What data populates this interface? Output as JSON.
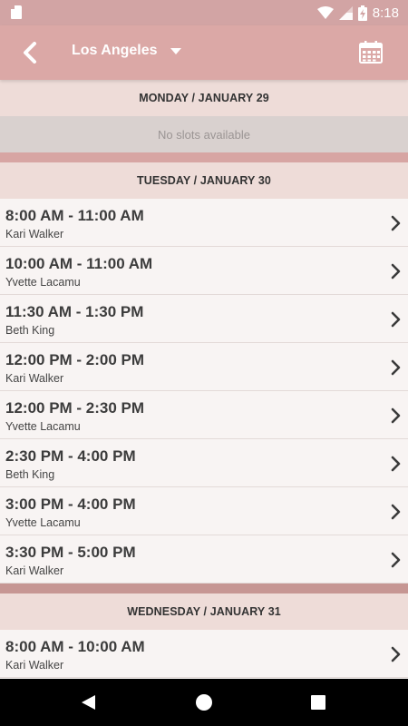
{
  "status_bar": {
    "time": "8:18",
    "icons": [
      "sd-card-icon",
      "wifi-icon",
      "signal-icon",
      "battery-charging-icon"
    ]
  },
  "app_bar": {
    "back_icon": "chevron-left-icon",
    "city": "Los Angeles",
    "dropdown_icon": "caret-down-icon",
    "calendar_icon": "calendar-icon"
  },
  "days": [
    {
      "header": "MONDAY / JANUARY 29",
      "empty_text": "No slots available"
    },
    {
      "header": "TUESDAY / JANUARY 30",
      "slots": [
        {
          "time": "8:00 AM - 11:00 AM",
          "name": "Kari Walker"
        },
        {
          "time": "10:00 AM - 11:00 AM",
          "name": "Yvette Lacamu"
        },
        {
          "time": "11:30 AM - 1:30 PM",
          "name": "Beth King"
        },
        {
          "time": "12:00 PM - 2:00 PM",
          "name": "Kari Walker"
        },
        {
          "time": "12:00 PM - 2:30 PM",
          "name": "Yvette Lacamu"
        },
        {
          "time": "2:30 PM - 4:00 PM",
          "name": "Beth King"
        },
        {
          "time": "3:00 PM - 4:00 PM",
          "name": "Yvette Lacamu"
        },
        {
          "time": "3:30 PM - 5:00 PM",
          "name": "Kari Walker"
        }
      ]
    },
    {
      "header": "WEDNESDAY / JANUARY 31",
      "slots": [
        {
          "time": "8:00 AM - 10:00 AM",
          "name": "Kari Walker"
        }
      ]
    }
  ],
  "nav_bar": {
    "icons": [
      "nav-back-icon",
      "nav-home-icon",
      "nav-recents-icon"
    ]
  }
}
